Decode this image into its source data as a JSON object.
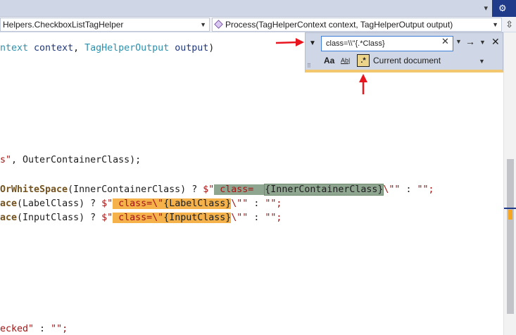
{
  "navbar": {
    "class_combo": "Helpers.CheckboxListTagHelper",
    "member_combo": "Process(TagHelperContext context, TagHelperOutput output)"
  },
  "find": {
    "search_value": "class=\\\\\"{.*Class}",
    "match_case_label": "Aa",
    "whole_word_label": "Ab|",
    "regex_label": ".*",
    "scope": "Current document"
  },
  "code": {
    "line1": {
      "a": "ntext ",
      "b": "context",
      "c": ", ",
      "d": "TagHelperOutput",
      "e": " ",
      "f": "output",
      "g": ")"
    },
    "line2": {
      "a": "s\"",
      "b": ", OuterContainerClass);"
    },
    "line3": {
      "a": "OrWhiteSpace",
      "b": "(InnerContainerClass) ? ",
      "c": "$\"",
      "d": " class=  ",
      "e": "{InnerContainerClass}",
      "f": "\\\"\"",
      "g": " : ",
      "h": "\"\";"
    },
    "line4": {
      "a": "ace",
      "b": "(LabelClass) ? ",
      "c": "$\"",
      "d": " class=\\\"",
      "e": "{LabelClass}",
      "f": "\\\"\"",
      "g": " : ",
      "h": "\"\";"
    },
    "line5": {
      "a": "ace",
      "b": "(InputClass) ? ",
      "c": "$\"",
      "d": " class=\\\"",
      "e": "{InputClass}",
      "f": "\\\"\"",
      "g": " : ",
      "h": "\"\";"
    },
    "line6": {
      "a": "ecked\"",
      "b": " : ",
      "c": "\"\";"
    }
  },
  "colors": {
    "match_highlight": "#f5b24a",
    "current_match_highlight": "#8ea58f",
    "annotation_arrow": "#e8141e",
    "find_panel_bg": "#cfd6e5"
  }
}
